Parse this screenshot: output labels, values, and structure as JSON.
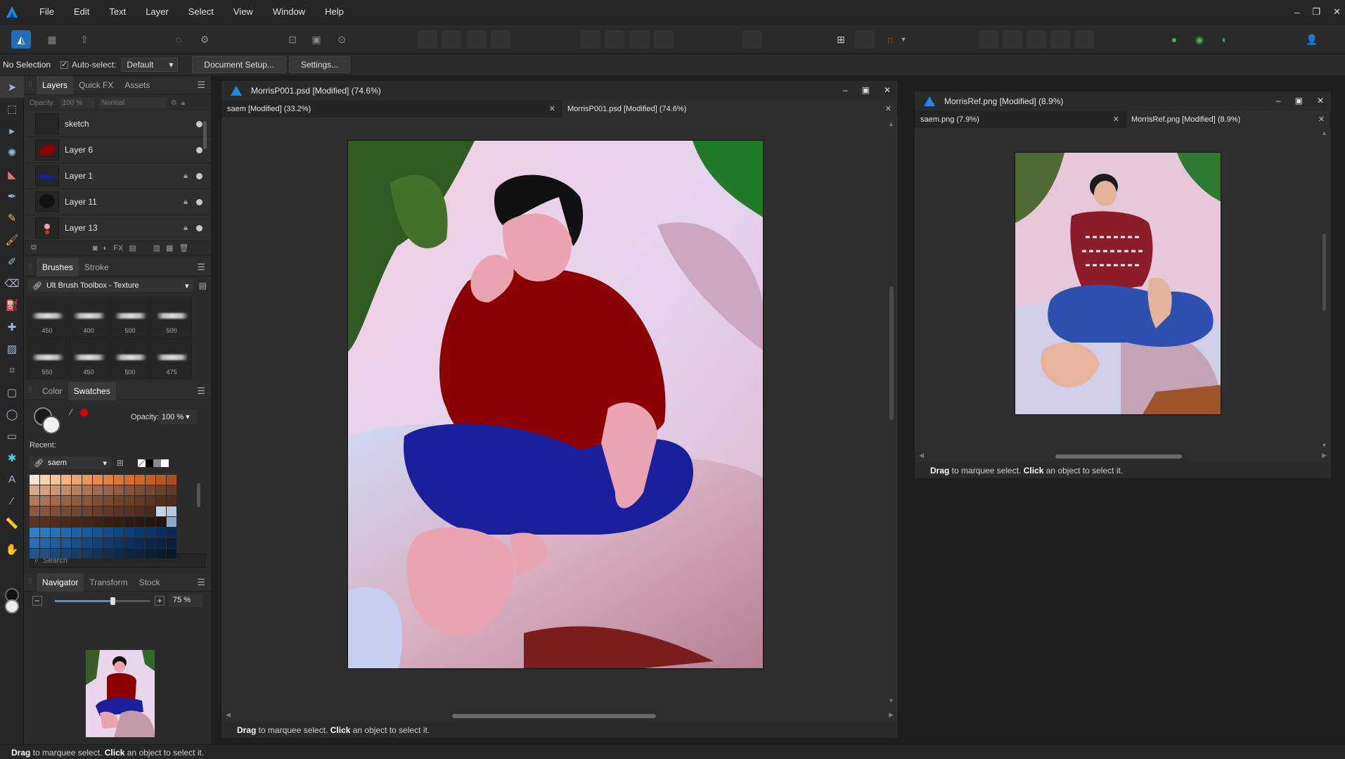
{
  "menubar": {
    "items": [
      "File",
      "Edit",
      "Text",
      "Layer",
      "Select",
      "View",
      "Window",
      "Help"
    ]
  },
  "contextbar": {
    "selection_status": "No Selection",
    "autoselect_label": "Auto-select:",
    "autoselect_value": "Default",
    "document_setup": "Document Setup...",
    "settings": "Settings..."
  },
  "layers_panel": {
    "tabs": [
      "Layers",
      "Quick FX",
      "Assets"
    ],
    "opacity_label": "Opacity:",
    "opacity_value": "100 %",
    "blend_mode": "Normal",
    "layers": [
      {
        "name": "sketch",
        "locked": false
      },
      {
        "name": "Layer 6",
        "locked": false
      },
      {
        "name": "Layer 1",
        "locked": true
      },
      {
        "name": "Layer 11",
        "locked": true
      },
      {
        "name": "Layer 13",
        "locked": true
      }
    ]
  },
  "brushes_panel": {
    "tabs": [
      "Brushes",
      "Stroke"
    ],
    "category": "Ult Brush Toolbox - Texture",
    "brushes": [
      "450",
      "400",
      "500",
      "500",
      "550",
      "450",
      "500",
      "475"
    ]
  },
  "color_panel": {
    "tabs": [
      "Color",
      "Swatches"
    ],
    "opacity_label": "Opacity:",
    "opacity_value": "100 %",
    "recent_label": "Recent:",
    "palette": "saem",
    "search_placeholder": "Search"
  },
  "navigator_panel": {
    "tabs": [
      "Navigator",
      "Transform",
      "Stock"
    ],
    "zoom_value": "75 %",
    "zoom_slider_fraction": 0.6
  },
  "doc_main": {
    "title": "MorrisP001.psd [Modified] (74.6%)",
    "tabs": [
      "saem [Modified] (33.2%)",
      "MorrisP001.psd [Modified] (74.6%)"
    ],
    "status_bold_1": "Drag",
    "status_text_1": " to marquee select. ",
    "status_bold_2": "Click",
    "status_text_2": " an object to select it."
  },
  "doc_ref": {
    "title": "MorrisRef.png [Modified] (8.9%)",
    "tabs": [
      "saem.png (7.9%)",
      "MorrisRef.png [Modified] (8.9%)"
    ],
    "status_bold_1": "Drag",
    "status_text_1": " to marquee select. ",
    "status_bold_2": "Click",
    "status_text_2": " an object to select it."
  },
  "app_status": {
    "bold_1": "Drag",
    "text_1": " to marquee select. ",
    "bold_2": "Click",
    "text_2": " an object to select it."
  },
  "colors": {
    "accent": "#1e6fb8",
    "sweater": "#8b0000",
    "pants": "#1a1f9c",
    "skin": "#eaa3b0",
    "record_red": "#d32f2f"
  }
}
